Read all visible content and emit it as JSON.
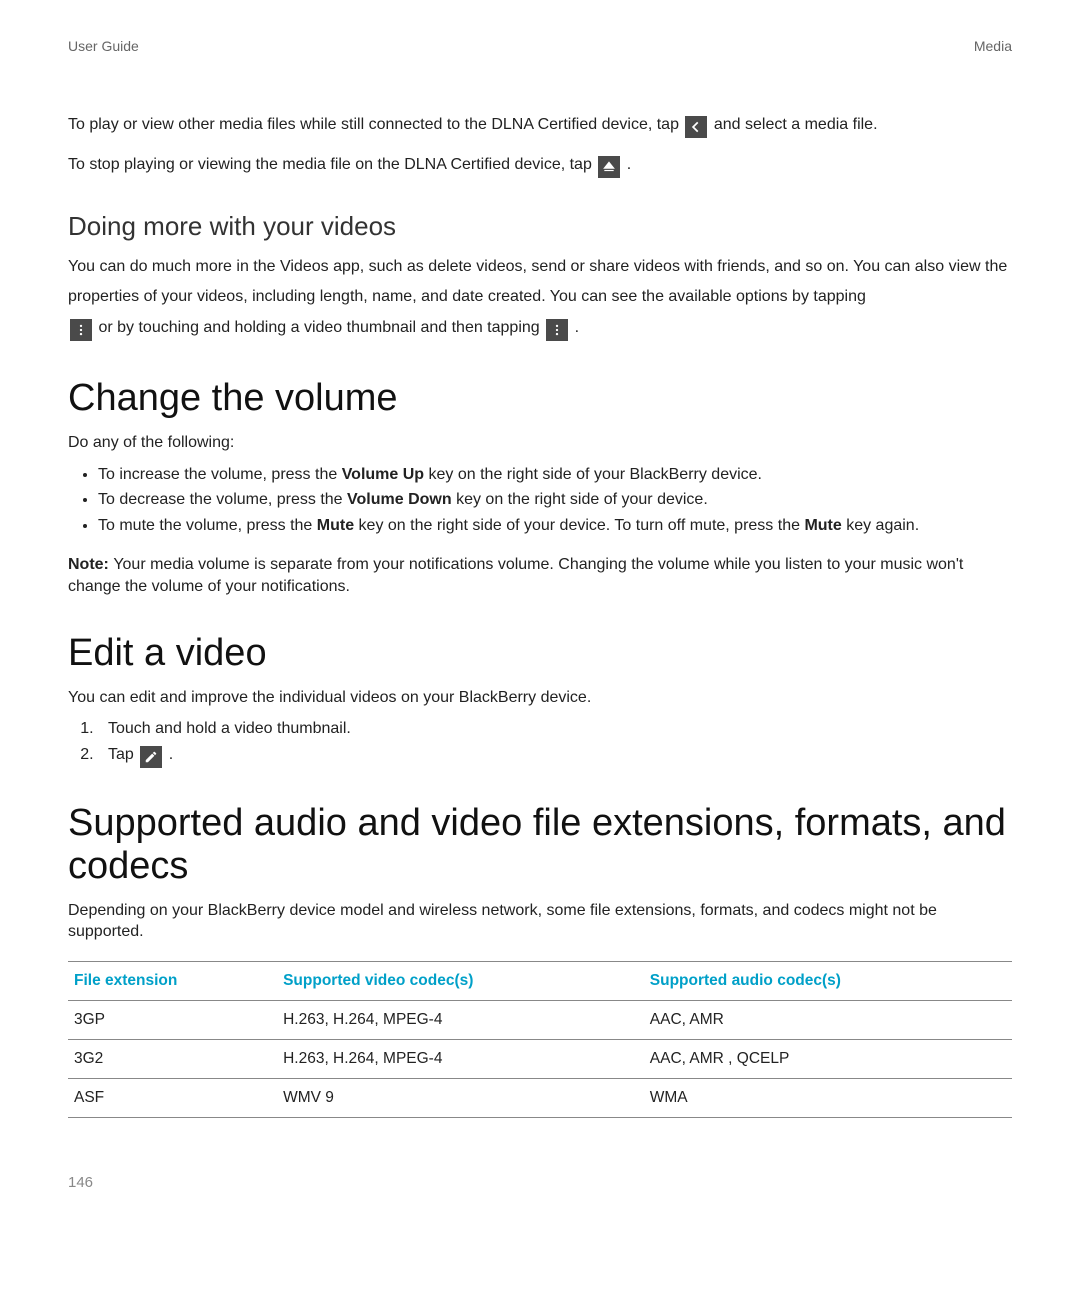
{
  "header": {
    "left": "User Guide",
    "right": "Media"
  },
  "intro": {
    "line1_pre": "To play or view other media files while still connected to the DLNA Certified device, tap ",
    "line1_post": " and select a media file.",
    "line2_pre": "To stop playing or viewing the media file on the DLNA Certified device, tap ",
    "line2_post": "."
  },
  "doing_more": {
    "heading": "Doing more with your videos",
    "body_part1": "You can do much more in the Videos app, such as delete videos, send or share videos with friends, and so on. You can also view the properties of your videos, including length, name, and date created. You can see the available options by tapping ",
    "mid": " or by touching and holding a video thumbnail and then tapping ",
    "post": "."
  },
  "change_volume": {
    "heading": "Change the volume",
    "lead": "Do any of the following:",
    "items": [
      {
        "pre": "To increase the volume, press the ",
        "bold": "Volume Up",
        "post": " key on the right side of your BlackBerry device."
      },
      {
        "pre": "To decrease the volume, press the ",
        "bold": "Volume Down",
        "post": " key on the right side of your device."
      },
      {
        "pre": "To mute the volume, press the ",
        "bold": "Mute",
        "post": " key on the right side of your device. To turn off mute, press the ",
        "bold2": "Mute",
        "post2": " key again."
      }
    ],
    "note_label": "Note: ",
    "note_text": "Your media volume is separate from your notifications volume. Changing the volume while you listen to your music won't change the volume of your notifications."
  },
  "edit_video": {
    "heading": "Edit a video",
    "lead": "You can edit and improve the individual videos on your BlackBerry device.",
    "steps": [
      "Touch and hold a video thumbnail.",
      "Tap "
    ],
    "step2_post": "."
  },
  "supported": {
    "heading": "Supported audio and video file extensions, formats, and codecs",
    "lead": "Depending on your BlackBerry device model and wireless network, some file extensions, formats, and codecs might not be supported.",
    "table": {
      "headers": [
        "File extension",
        "Supported video codec(s)",
        "Supported audio codec(s)"
      ],
      "rows": [
        [
          "3GP",
          "H.263, H.264, MPEG-4",
          "AAC, AMR"
        ],
        [
          "3G2",
          "H.263, H.264, MPEG-4",
          "AAC, AMR , QCELP"
        ],
        [
          "ASF",
          "WMV 9",
          "WMA"
        ]
      ]
    }
  },
  "page_number": "146",
  "colors": {
    "teal": "#00a0c8",
    "icon_bg": "#4a4a4a"
  }
}
